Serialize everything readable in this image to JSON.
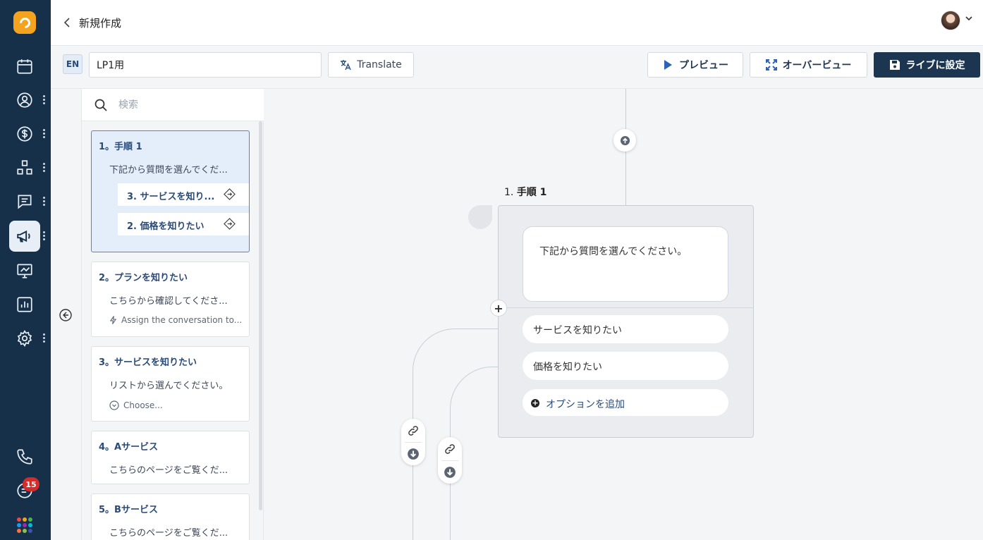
{
  "header": {
    "back_label": "<",
    "title": "新規作成"
  },
  "toolbar": {
    "lang": "EN",
    "name_value": "LP1用",
    "translate_label": "Translate",
    "preview_label": "プレビュー",
    "overview_label": "オーバービュー",
    "golive_label": "ライブに設定"
  },
  "sidebar": {
    "badge_count": "15"
  },
  "search": {
    "placeholder": "検索"
  },
  "steps": [
    {
      "title": "1。手順 1",
      "desc": "下記から質問を選んでくだ...",
      "options": [
        "3. サービスを知り...",
        "2. 価格を知りたい"
      ]
    },
    {
      "title": "2。プランを知りたい",
      "desc": "こちらから確認してくださ...",
      "meta": "Assign the conversation to..."
    },
    {
      "title": "3。サービスを知りたい",
      "desc": "リストから選んでください。",
      "meta": "Choose..."
    },
    {
      "title": "4。Aサービス",
      "desc": "こちらのページをご覧くだ..."
    },
    {
      "title": "5。Bサービス",
      "desc": "こちらのページをご覧くだ..."
    }
  ],
  "canvas": {
    "node_number": "1.",
    "node_title": "手順 1",
    "message": "下記から質問を選んでください。",
    "choices": [
      "サービスを知りたい",
      "価格を知りたい"
    ],
    "add_option": "オプションを追加"
  },
  "colors": {
    "rail": "#16304a",
    "accent": "#2a4b78",
    "primary_button": "#1c3652",
    "logo": "#f4a31e",
    "badge": "#d62b2b"
  }
}
